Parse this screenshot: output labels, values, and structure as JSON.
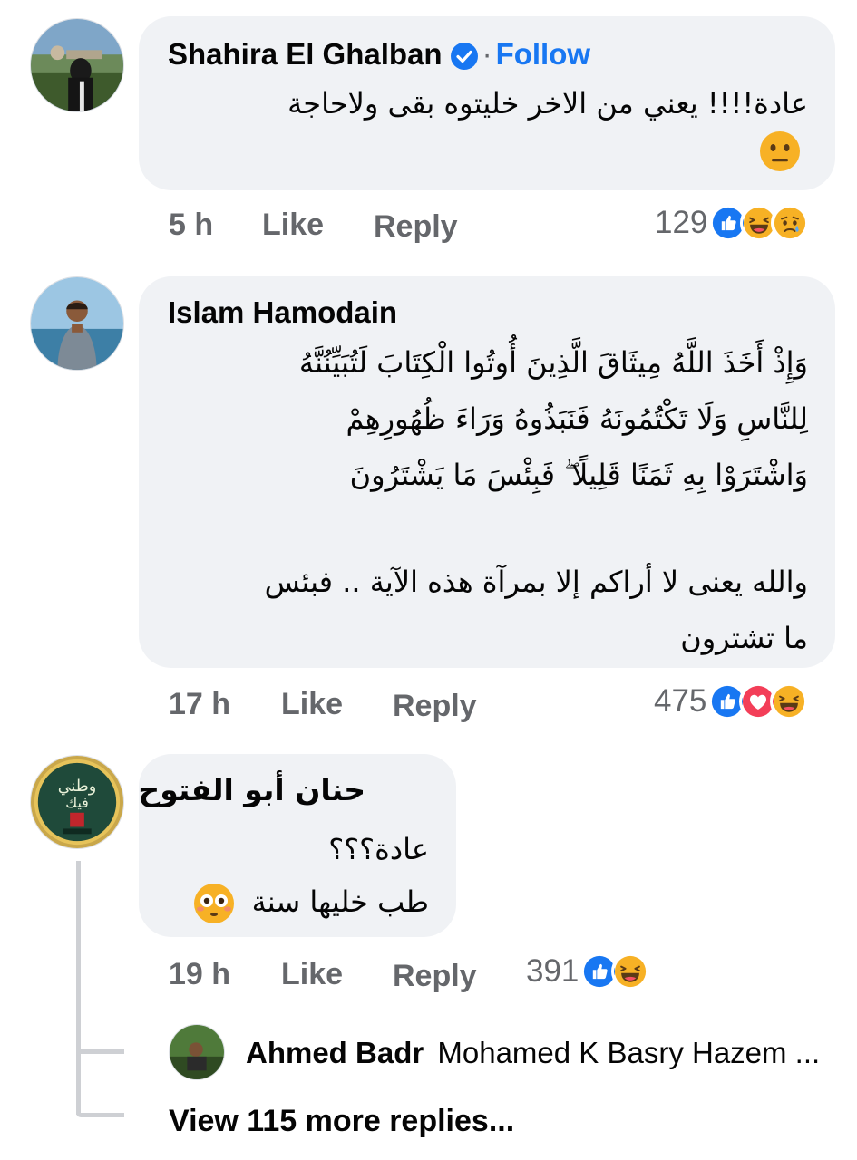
{
  "comments": [
    {
      "author": "Shahira El Ghalban",
      "verified": true,
      "follow_label": "Follow",
      "text_lines": [
        "عادة!!!! يعني من الاخر خليتوه بقى ولاحاجة"
      ],
      "trailing_emoji": "neutral-face",
      "time": "5 h",
      "like_label": "Like",
      "reply_label": "Reply",
      "reaction_count": "129",
      "reactions": [
        "like",
        "haha",
        "sad"
      ]
    },
    {
      "author": "Islam Hamodain",
      "text_lines": [
        "وَإِذْ أَخَذَ اللَّهُ مِيثَاقَ الَّذِينَ أُوتُوا الْكِتَابَ لَتُبَيِّنُنَّهُ",
        "لِلنَّاسِ وَلَا تَكْتُمُونَهُ فَنَبَذُوهُ وَرَاءَ ظُهُورِهِمْ",
        "وَاشْتَرَوْا بِهِ ثَمَنًا قَلِيلًا ۖ فَبِئْسَ مَا يَشْتَرُونَ",
        "",
        "والله يعنى لا أراكم إلا بمرآة هذه الآية .. فبئس",
        "ما تشترون"
      ],
      "time": "17 h",
      "like_label": "Like",
      "reply_label": "Reply",
      "reaction_count": "475",
      "reactions": [
        "like",
        "love",
        "haha"
      ]
    },
    {
      "author": "حنان أبو الفتوح",
      "text_lines": [
        "عادة؟؟؟",
        "طب خليها سنة"
      ],
      "trailing_emoji": "flushed-face",
      "time": "19 h",
      "like_label": "Like",
      "reply_label": "Reply",
      "reaction_count": "391",
      "reactions": [
        "like",
        "haha"
      ],
      "reply_preview": {
        "author": "Ahmed Badr",
        "text": "Mohamed K Basry Hazem ..."
      },
      "view_more_label": "View 115 more replies..."
    }
  ],
  "colors": {
    "bubble": "#f0f2f5",
    "meta": "#65676b",
    "link": "#1877f2",
    "like": "#1877f2",
    "love": "#f33e58",
    "emoji_yellow": "#f7b125"
  }
}
